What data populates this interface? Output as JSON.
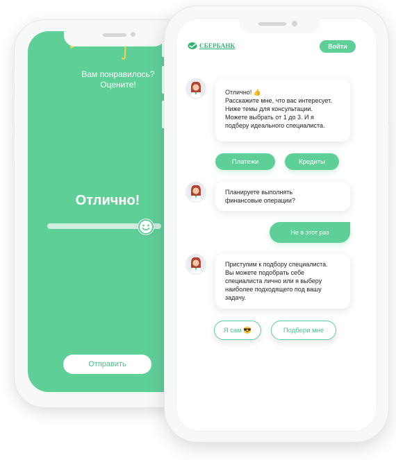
{
  "back_screen": {
    "question_line1": "Вам понравилось?",
    "question_line2": "Оцените!",
    "rating_result": "Отлично!",
    "rating_level": 0.9,
    "send_label": "Отправить",
    "smiley_glyph": "☺",
    "icons": [
      "confetti-icon",
      "smiley-icon"
    ]
  },
  "front_screen": {
    "brand": "СБЕРБАНК",
    "login_label": "Войти",
    "messages": [
      {
        "lines": [
          "Отлично! 👍",
          "Расскажите мне, что вас интересует.",
          "Ниже темы для консультации.",
          "Можете выбрать от 1 до 3. И я",
          "подберу  идеального специалиста."
        ]
      },
      {
        "lines": [
          "Планируете выполнять",
          "финансовые операции?"
        ]
      },
      {
        "lines": [
          "Приступим к подбору специалиста.",
          "Вы можете подобрать себе",
          "специалиста лично или я выберу",
          "наиболее подходящего под вашу",
          "задачу."
        ]
      }
    ],
    "topic_chips": [
      "Платежи",
      "Кредиты"
    ],
    "user_reply": "Не в этот раз",
    "choice_chips": [
      "Я сам 😎",
      "Подбери мне"
    ]
  },
  "colors": {
    "accent_green": "#5fcf98",
    "text_green": "#4bc18a",
    "confetti_yellow": "#f5d34a"
  }
}
